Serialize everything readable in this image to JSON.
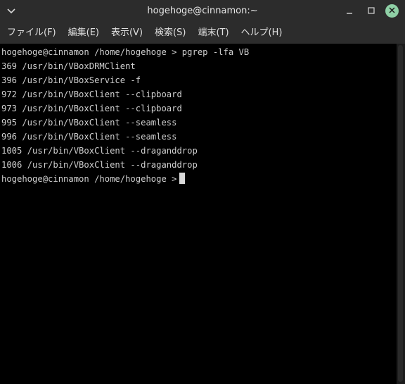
{
  "window": {
    "title": "hogehoge@cinnamon:~",
    "menu_icon": "chevron-down-icon",
    "minimize_icon": "minimize-icon",
    "maximize_icon": "maximize-icon",
    "close_icon": "close-icon",
    "close_color": "#8fd0a6"
  },
  "menubar": {
    "items": [
      {
        "label": "ファイル(F)"
      },
      {
        "label": "編集(E)"
      },
      {
        "label": "表示(V)"
      },
      {
        "label": "検索(S)"
      },
      {
        "label": "端末(T)"
      },
      {
        "label": "ヘルプ(H)"
      }
    ]
  },
  "terminal": {
    "lines": [
      "hogehoge@cinnamon /home/hogehoge > pgrep -lfa VB",
      "369 /usr/bin/VBoxDRMClient",
      "396 /usr/bin/VBoxService -f",
      "972 /usr/bin/VBoxClient --clipboard",
      "973 /usr/bin/VBoxClient --clipboard",
      "995 /usr/bin/VBoxClient --seamless",
      "996 /usr/bin/VBoxClient --seamless",
      "1005 /usr/bin/VBoxClient --draganddrop",
      "1006 /usr/bin/VBoxClient --draganddrop"
    ],
    "prompt": "hogehoge@cinnamon /home/hogehoge >"
  }
}
